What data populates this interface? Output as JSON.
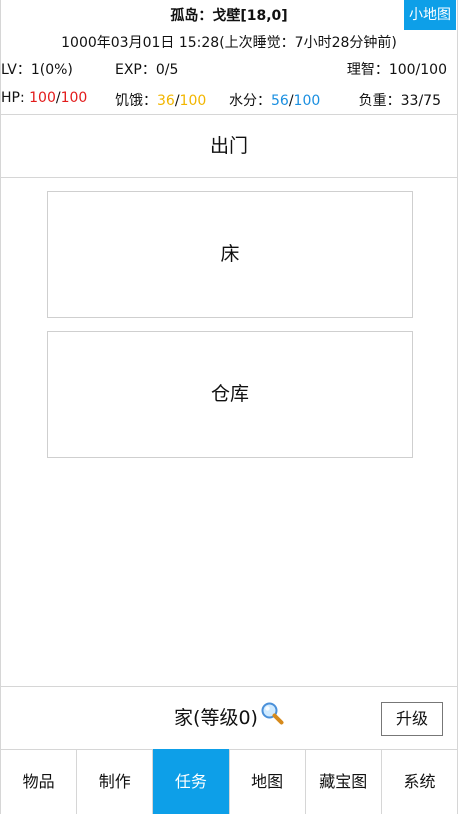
{
  "header": {
    "location": "孤岛：戈壁[18,0]",
    "minimap_label": "小地图",
    "datetime": "1000年03月01日 15:28(上次睡觉：7小时28分钟前)"
  },
  "stats": {
    "lv": {
      "label": "LV：",
      "value": "1(0%)"
    },
    "exp": {
      "label": "EXP：",
      "value": "0/5"
    },
    "sanity": {
      "label": "理智：",
      "value": "100/100"
    },
    "hp": {
      "label": "HP: ",
      "cur": "100",
      "sep": "/",
      "max": "100"
    },
    "hunger": {
      "label": "饥饿：",
      "cur": "36",
      "sep": "/",
      "max": "100"
    },
    "water": {
      "label": "水分：",
      "cur": "56",
      "sep": "/",
      "max": "100"
    },
    "load": {
      "label": "负重：",
      "value": "33/75"
    }
  },
  "colors": {
    "accent": "#0d9fe8",
    "hp": "#e21b1b",
    "hunger": "#f2b600",
    "water": "#1a8fe0"
  },
  "main": {
    "go_out_label": "出门",
    "facilities": [
      {
        "label": "床"
      },
      {
        "label": "仓库"
      }
    ]
  },
  "home": {
    "title": "家(等级0)",
    "icon": "magnifier-icon",
    "upgrade_label": "升级"
  },
  "tabs": [
    {
      "label": "物品",
      "active": false
    },
    {
      "label": "制作",
      "active": false
    },
    {
      "label": "任务",
      "active": true
    },
    {
      "label": "地图",
      "active": false
    },
    {
      "label": "藏宝图",
      "active": false
    },
    {
      "label": "系统",
      "active": false
    }
  ]
}
